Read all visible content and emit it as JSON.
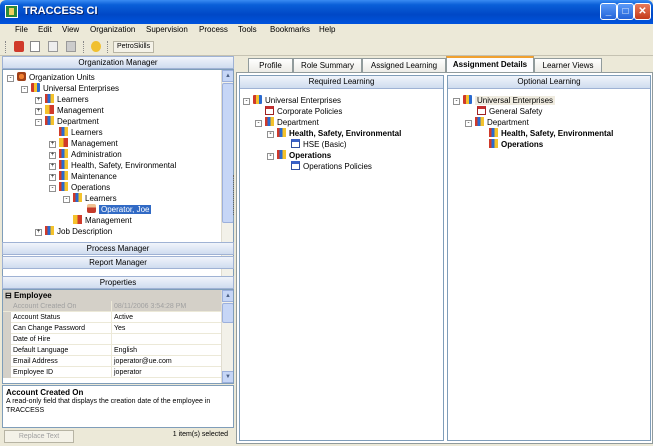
{
  "window": {
    "title": "TRACCESS CI",
    "min": "_",
    "max": "□",
    "close": "✕"
  },
  "menu": [
    "File",
    "Edit",
    "View",
    "Organization",
    "Supervision",
    "Process",
    "Tools",
    "Bookmarks",
    "Help"
  ],
  "toolbar": {
    "petroskills_label": "PetroSkills"
  },
  "left": {
    "org_manager_title": "Organization Manager",
    "tree": [
      {
        "text": "Organization Units",
        "icon": "org-root",
        "expander": "-"
      },
      {
        "text": "Universal Enterprises",
        "icon": "org",
        "expander": "-"
      },
      {
        "text": "Learners",
        "icon": "folder",
        "expander": "+"
      },
      {
        "text": "Management",
        "icon": "mgmt",
        "expander": "+"
      },
      {
        "text": "Department",
        "icon": "folder",
        "expander": "-"
      },
      {
        "text": "Learners",
        "icon": "folder",
        "expander": ""
      },
      {
        "text": "Management",
        "icon": "mgmt",
        "expander": "+"
      },
      {
        "text": "Administration",
        "icon": "folder",
        "expander": "+"
      },
      {
        "text": "Health, Safety, Environmental",
        "icon": "folder",
        "expander": "+"
      },
      {
        "text": "Maintenance",
        "icon": "folder",
        "expander": "+"
      },
      {
        "text": "Operations",
        "icon": "folder",
        "expander": "-"
      },
      {
        "text": "Learners",
        "icon": "folder",
        "expander": "-"
      },
      {
        "text": "Operator, Joe",
        "icon": "user",
        "expander": ""
      },
      {
        "text": "Management",
        "icon": "mgmt",
        "expander": ""
      },
      {
        "text": "Job Description",
        "icon": "folder",
        "expander": "+"
      }
    ],
    "process_manager_title": "Process Manager",
    "report_manager_title": "Report Manager",
    "properties_title": "Properties",
    "properties_category": "Employee",
    "properties": [
      {
        "key": "Account Created On",
        "value": "08/11/2006 3:54:28 PM"
      },
      {
        "key": "Account Status",
        "value": "Active"
      },
      {
        "key": "Can Change Password",
        "value": "Yes"
      },
      {
        "key": "Date of Hire",
        "value": ""
      },
      {
        "key": "Default Language",
        "value": "English"
      },
      {
        "key": "Email Address",
        "value": "joperator@ue.com"
      },
      {
        "key": "Employee ID",
        "value": "joperator"
      }
    ],
    "description_title": "Account Created On",
    "description_text": "A read-only field that displays the creation date of the employee in TRACCESS",
    "replace_text_button": "Replace Text",
    "status_count": "1 item(s) selected"
  },
  "tabs": [
    "Profile",
    "Role Summary",
    "Assigned Learning",
    "Assignment Details",
    "Learner Views"
  ],
  "active_tab": "Assignment Details",
  "required": {
    "title": "Required Learning",
    "tree": [
      {
        "text": "Universal Enterprises",
        "icon": "org",
        "expander": "-",
        "bold": false
      },
      {
        "text": "Corporate Policies",
        "icon": "policy",
        "expander": "",
        "bold": false
      },
      {
        "text": "Department",
        "icon": "folder",
        "expander": "-",
        "bold": false
      },
      {
        "text": "Health, Safety, Environmental",
        "icon": "folder",
        "expander": "-",
        "bold": true
      },
      {
        "text": "HSE (Basic)",
        "icon": "course",
        "expander": "",
        "bold": false
      },
      {
        "text": "Operations",
        "icon": "folder",
        "expander": "-",
        "bold": true
      },
      {
        "text": "Operations Policies",
        "icon": "course",
        "expander": "",
        "bold": false
      }
    ]
  },
  "optional": {
    "title": "Optional Learning",
    "tree": [
      {
        "text": "Universal Enterprises",
        "icon": "org",
        "expander": "-",
        "bold": false
      },
      {
        "text": "General Safety",
        "icon": "policy",
        "expander": "",
        "bold": false
      },
      {
        "text": "Department",
        "icon": "folder",
        "expander": "-",
        "bold": false
      },
      {
        "text": "Health, Safety, Environmental",
        "icon": "folder",
        "expander": "",
        "bold": true
      },
      {
        "text": "Operations",
        "icon": "folder",
        "expander": "",
        "bold": true
      }
    ]
  }
}
